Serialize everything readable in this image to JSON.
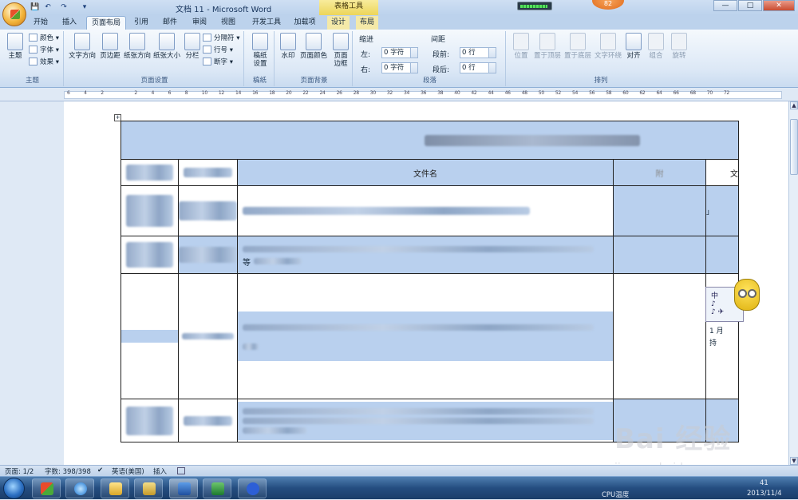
{
  "window": {
    "title": "文档 11 - Microsoft Word",
    "context_tab": "表格工具",
    "controls": {
      "minimize": "—",
      "maximize": "□",
      "close": "✕"
    }
  },
  "quick_access": {
    "save": "💾",
    "undo": "↶",
    "redo": "↷",
    "more": "▾"
  },
  "gadgets": {
    "temp_badge": "82"
  },
  "tabs": [
    "开始",
    "插入",
    "页面布局",
    "引用",
    "邮件",
    "审阅",
    "视图",
    "开发工具",
    "加载项",
    "设计",
    "布局"
  ],
  "active_tab": "页面布局",
  "ribbon": {
    "groups": {
      "theme": "主题",
      "page_setup": "页面设置",
      "manuscript": "稿纸",
      "page_bg": "页面背景",
      "paragraph": "段落",
      "arrange": "排列"
    },
    "theme": {
      "big": "主题",
      "colors": "颜色 ▾",
      "fonts": "字体 ▾",
      "effects": "效果 ▾"
    },
    "page_setup": {
      "text_direction": "文字方向",
      "margins": "页边距",
      "orientation": "纸张方向",
      "size": "纸张大小",
      "columns": "分栏",
      "breaks": "分隔符 ▾",
      "line_numbers": "行号 ▾",
      "hyphenation": "断字 ▾"
    },
    "manuscript": {
      "settings_line1": "稿纸",
      "settings_line2": "设置"
    },
    "page_bg": {
      "watermark": "水印",
      "page_color": "页面颜色",
      "borders_line1": "页面",
      "borders_line2": "边框"
    },
    "paragraph": {
      "indent_label": "缩进",
      "spacing_label": "间距",
      "left_label": "左:",
      "right_label": "右:",
      "before_label": "段前:",
      "after_label": "段后:",
      "left_value": "0 字符",
      "right_value": "0 字符",
      "before_value": "0 行",
      "after_value": "0 行"
    },
    "arrange": {
      "position": "位置",
      "bring_front": "置于顶层",
      "send_back": "置于底层",
      "wrap": "文字环绕",
      "align": "对齐",
      "group": "组合",
      "rotate": "旋转"
    }
  },
  "ruler": {
    "ticks": [
      "6",
      "4",
      "2",
      "",
      "2",
      "4",
      "6",
      "8",
      "10",
      "12",
      "14",
      "16",
      "18",
      "20",
      "22",
      "24",
      "26",
      "28",
      "30",
      "32",
      "34",
      "36",
      "38",
      "40",
      "42",
      "44",
      "46",
      "48",
      "50",
      "52",
      "54",
      "56",
      "58",
      "60",
      "62",
      "64",
      "66",
      "68",
      "70",
      "72"
    ]
  },
  "table": {
    "title_blurred": "■■■ ■■■■■■■■■■■",
    "header_filename": "文件名",
    "header_col4": "附",
    "header_col5": "文",
    "row2_col5_text": "」",
    "row3_col3_extra": "等",
    "row4_col5_top": "1 月",
    "row4_col5_bottom": "持"
  },
  "sticker": {
    "line1": "中",
    "line2": "♪ ",
    "line3": "♪ ✈"
  },
  "statusbar": {
    "page": "页面: 1/2",
    "words": "字数: 398/398",
    "language": "英语(美国)",
    "mode": "插入"
  },
  "taskbar": {
    "cpu_label": "CPU温度",
    "date": "2013/11/4",
    "time": "41"
  },
  "watermark": {
    "logo": "Bai 经验",
    "url": "jingyan.baidu.com"
  }
}
